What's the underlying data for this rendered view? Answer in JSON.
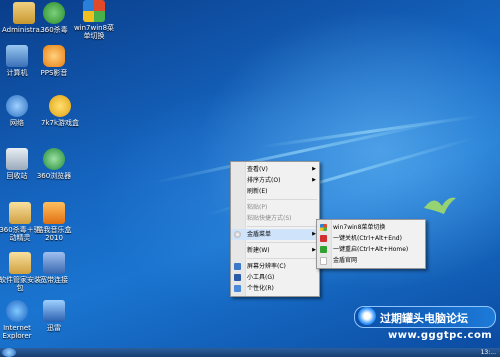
{
  "desktop_icons": [
    {
      "label": "Administra...",
      "color": "#d9a84a"
    },
    {
      "label": "360杀毒",
      "color": "#3aa63a"
    },
    {
      "label": "win7win8菜单切换",
      "color": "#e1e1e1"
    },
    {
      "label": "计算机",
      "color": "#6aa0d8"
    },
    {
      "label": "PPS影音",
      "color": "#f39c1f"
    },
    {
      "label": "网络",
      "color": "#4a90d9"
    },
    {
      "label": "7k7k游戏盒",
      "color": "#f5c430"
    },
    {
      "label": "回收站",
      "color": "#c8d4e0"
    },
    {
      "label": "360浏览器",
      "color": "#2ea043"
    },
    {
      "label": "360杀毒＋驱动精灵",
      "color": "#e8b84a"
    },
    {
      "label": "酷我音乐盒2010",
      "color": "#f0a030"
    },
    {
      "label": "软件管家安装包",
      "color": "#e8c060"
    },
    {
      "label": "宽带连接",
      "color": "#5a8ad0"
    },
    {
      "label": "Internet Explorer",
      "color": "#2a7fd8"
    },
    {
      "label": "迅雷",
      "color": "#3a78c8"
    }
  ],
  "context_menu": {
    "items": [
      {
        "label": "查看(V)",
        "submenu": true,
        "disabled": false
      },
      {
        "label": "排序方式(O)",
        "submenu": true,
        "disabled": false
      },
      {
        "label": "刷新(E)",
        "submenu": false,
        "disabled": false
      },
      {
        "label": "粘贴(P)",
        "submenu": false,
        "disabled": true
      },
      {
        "label": "粘贴快捷方式(S)",
        "submenu": false,
        "disabled": true
      },
      {
        "label": "金盾菜单",
        "submenu": true,
        "disabled": false,
        "highlighted": true,
        "icon": "jindun-icon"
      },
      {
        "label": "新建(W)",
        "submenu": true,
        "disabled": false
      },
      {
        "label": "屏幕分辨率(C)",
        "submenu": false,
        "disabled": false,
        "icon": "display-icon"
      },
      {
        "label": "小工具(G)",
        "submenu": false,
        "disabled": false,
        "icon": "gadget-icon"
      },
      {
        "label": "个性化(R)",
        "submenu": false,
        "disabled": false,
        "icon": "personalize-icon"
      }
    ]
  },
  "submenu": {
    "items": [
      {
        "label": "win7win8菜单切换",
        "icon": "switch-icon",
        "color": "#e04a2a"
      },
      {
        "label": "一键关机(Ctrl+Alt+End)",
        "icon": "shutdown-icon",
        "color": "#d03030"
      },
      {
        "label": "一键重启(Ctrl+Alt+Home)",
        "icon": "restart-icon",
        "color": "#30a030"
      },
      {
        "label": "金盾官网",
        "icon": "website-icon",
        "color": "#dddddd"
      }
    ]
  },
  "watermark": {
    "title": "过期罐头电脑论坛",
    "url": "www.gggtpc.com"
  },
  "taskbar": {
    "clock": "13:..."
  }
}
